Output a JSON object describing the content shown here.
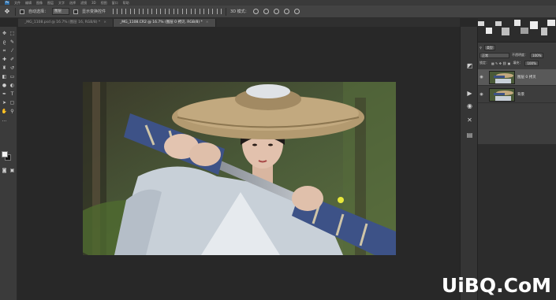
{
  "menubar": {
    "items": [
      "文件",
      "编辑",
      "图像",
      "图层",
      "文字",
      "选择",
      "滤镜",
      "3D",
      "视图",
      "窗口",
      "帮助"
    ]
  },
  "options": {
    "tool_icon": "move-tool-icon",
    "auto_select_label": "自动选择：",
    "auto_select_value": "图层",
    "show_transform_label": "显示变换控件",
    "mode_3d_label": "3D 模式："
  },
  "tabs": [
    {
      "label": "_MG_1108.psd @ 16.7% (图层 16, RGB/8) *",
      "active": false
    },
    {
      "label": "_MG_1108.CR2 @ 16.7% (图层 0 拷贝, RGB/8) *",
      "active": true
    }
  ],
  "layers_panel": {
    "kind_label": "类型",
    "blend_mode": "正常",
    "opacity_label": "不透明度：",
    "opacity_value": "100%",
    "lock_label": "锁定：",
    "fill_label": "填充：",
    "fill_value": "100%",
    "layers": [
      {
        "name": "图层 0 拷贝",
        "selected": true
      },
      {
        "name": "背景",
        "selected": false
      }
    ]
  },
  "watermark": "UiBQ.CoM",
  "colors": {
    "accent": "#2d6ea8",
    "canvas_bg": "#282828",
    "panel_bg": "#3d3d3d",
    "foreground_swatch": "#f2f2f2",
    "background_swatch": "#111111"
  }
}
